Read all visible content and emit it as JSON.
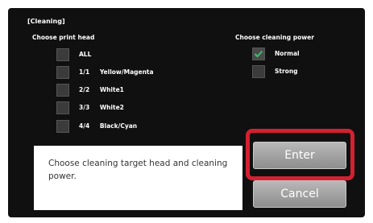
{
  "section_title": "[Cleaning]",
  "print_head": {
    "heading": "Choose print head",
    "items": [
      {
        "num": "",
        "label": "ALL",
        "checked": false
      },
      {
        "num": "1/1",
        "label": "Yellow/Magenta",
        "checked": false
      },
      {
        "num": "2/2",
        "label": "White1",
        "checked": false
      },
      {
        "num": "3/3",
        "label": "White2",
        "checked": false
      },
      {
        "num": "4/4",
        "label": "Black/Cyan",
        "checked": false
      }
    ]
  },
  "cleaning_power": {
    "heading": "Choose cleaning power",
    "items": [
      {
        "label": "Normal",
        "checked": true
      },
      {
        "label": "Strong",
        "checked": false
      }
    ]
  },
  "message": "Choose cleaning target head and cleaning power.",
  "buttons": {
    "enter": "Enter",
    "cancel": "Cancel"
  },
  "colors": {
    "highlight": "#d42030",
    "checkmark": "#3fbf6a",
    "screen_bg": "#101010"
  }
}
